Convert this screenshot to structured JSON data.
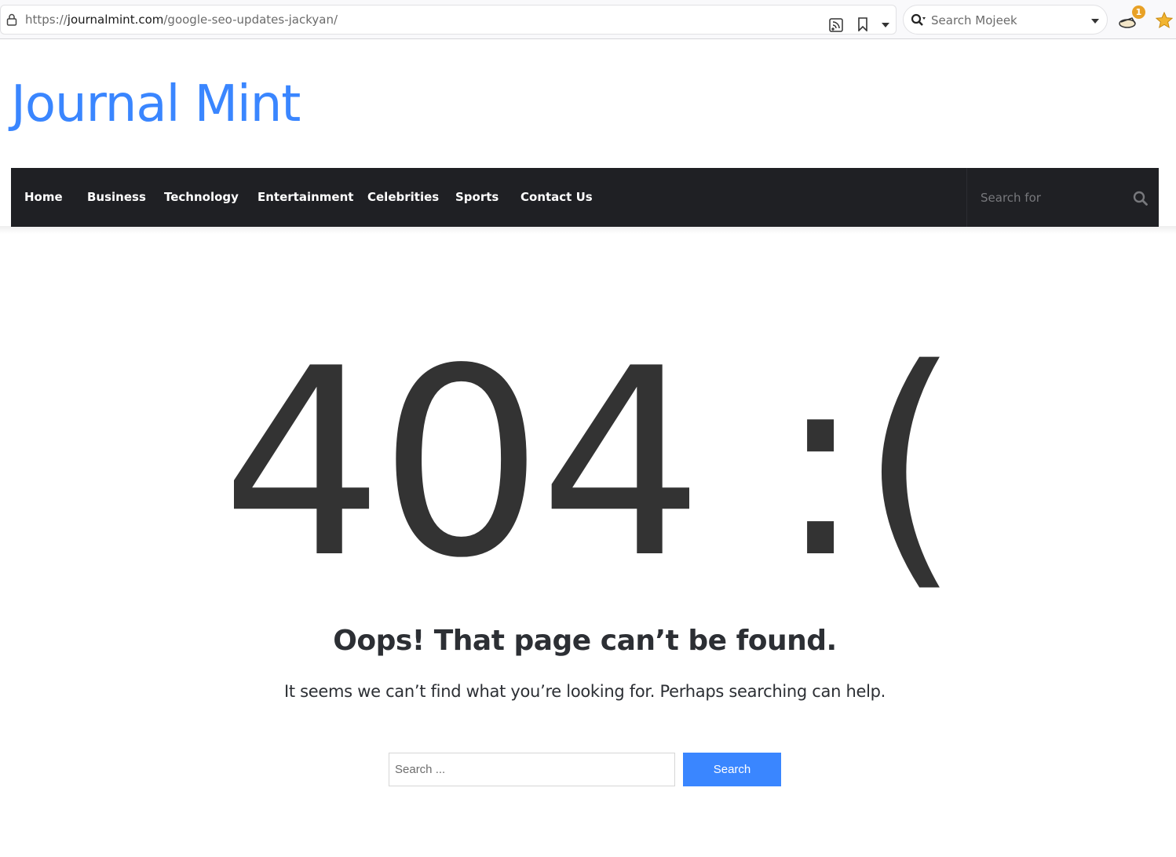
{
  "browser": {
    "url_scheme": "https://",
    "url_domain": "journalmint.com",
    "url_path": "/google-seo-updates-jackyan/",
    "search_placeholder": "Search Mojeek",
    "extension_badge": "1"
  },
  "site": {
    "logo": "Journal Mint"
  },
  "nav": {
    "items": [
      {
        "label": "Home"
      },
      {
        "label": "Business"
      },
      {
        "label": "Technology"
      },
      {
        "label": "Entertainment"
      },
      {
        "label": "Celebrities"
      },
      {
        "label": "Sports"
      },
      {
        "label": "Contact Us"
      }
    ],
    "search_placeholder": "Search for"
  },
  "error": {
    "code_text": "404 :(",
    "title": "Oops! That page can’t be found.",
    "message": "It seems we can’t find what you’re looking for. Perhaps searching can help.",
    "search_placeholder": "Search ...",
    "search_button": "Search"
  },
  "colors": {
    "accent": "#3a86ff",
    "nav_background": "#1f2024",
    "text": "#2c2f34",
    "big_404": "#333333"
  }
}
